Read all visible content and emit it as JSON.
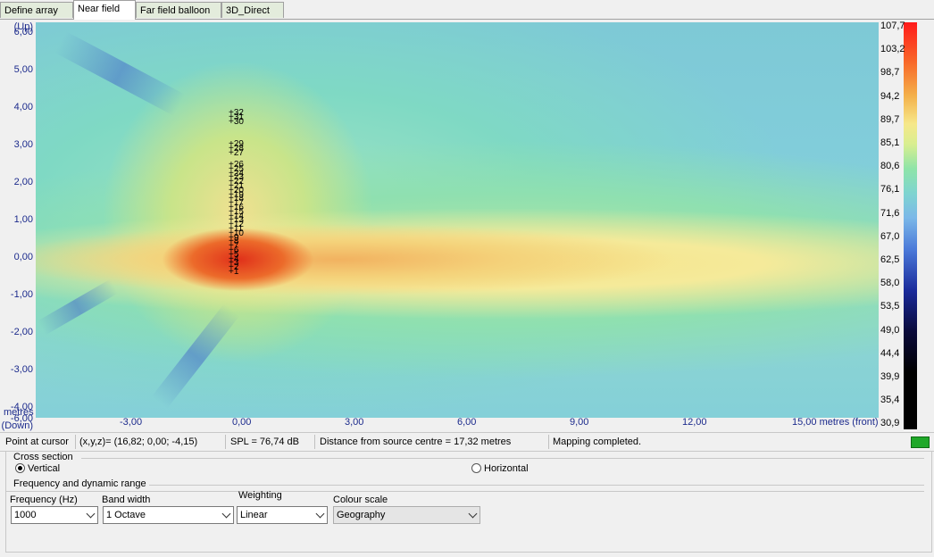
{
  "tabs": [
    {
      "label": "Define array",
      "active": false
    },
    {
      "label": "Near field",
      "active": true
    },
    {
      "label": "Far field balloon",
      "active": false
    },
    {
      "label": "3D_Direct",
      "active": false
    }
  ],
  "plot": {
    "y_top_label": "(Up)",
    "y_bottom_label": "(Down)",
    "y_ticks": [
      "6,00",
      "5,00",
      "4,00",
      "3,00",
      "2,00",
      "1,00",
      "0,00",
      "-1,00",
      "-2,00",
      "-3,00",
      "-4,00",
      "-6,00"
    ],
    "x_unit_label": "metres",
    "x_ticks": [
      "-3,00",
      "0,00",
      "3,00",
      "6,00",
      "9,00",
      "12,00",
      "15,00 metres (front)"
    ],
    "colour_scale_values": [
      "107,7",
      "103,2",
      "98,7",
      "94,2",
      "89,7",
      "85,1",
      "80,6",
      "76,1",
      "71,6",
      "67,0",
      "62,5",
      "58,0",
      "53,5",
      "49,0",
      "44,4",
      "39,9",
      "35,4",
      "30,9"
    ],
    "mic_labels": [
      "32",
      "31",
      "30",
      "29",
      "28",
      "27",
      "26",
      "25",
      "24",
      "23",
      "22",
      "21",
      "20",
      "19",
      "18",
      "17",
      "16",
      "15",
      "14",
      "13",
      "12",
      "11",
      "10",
      "9",
      "8",
      "7",
      "6",
      "5",
      "4",
      "3",
      "2",
      "1"
    ]
  },
  "status": {
    "point_label": "Point at cursor",
    "point_value": "(x,y,z)= (16,82; 0,00; -4,15)",
    "spl": "SPL = 76,74 dB",
    "distance": "Distance from source centre = 17,32 metres",
    "message": "Mapping completed.",
    "led_color": "#1fa829"
  },
  "cross_section": {
    "title": "Cross section",
    "vertical_label": "Vertical",
    "horizontal_label": "Horizontal",
    "selected": "Vertical"
  },
  "freq_group": {
    "title": "Frequency and dynamic range",
    "frequency_label": "Frequency (Hz)",
    "frequency_value": "1000",
    "bandwidth_label": "Band width",
    "bandwidth_value": "1 Octave",
    "weighting_label": "Weighting",
    "weighting_value": "Linear",
    "colour_scale_label": "Colour scale",
    "colour_scale_value": "Geography"
  }
}
